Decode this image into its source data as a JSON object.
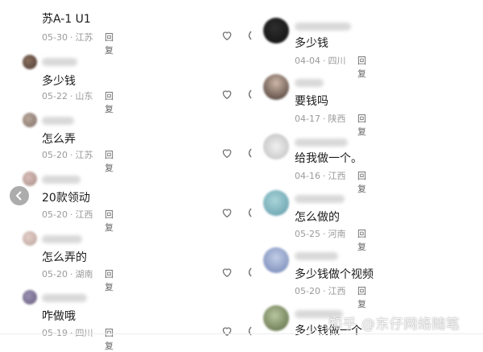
{
  "reply_label": "回复",
  "meta_separator": "·",
  "left_comments": [
    {
      "text": "苏A-1  U1",
      "date": "05-30",
      "location": "江苏"
    },
    {
      "text": "多少钱",
      "date": "05-22",
      "location": "山东"
    },
    {
      "text": "怎么弄",
      "date": "05-20",
      "location": "江苏"
    },
    {
      "text": "20款领动",
      "date": "05-20",
      "location": "江西"
    },
    {
      "text": "怎么弄的",
      "date": "05-20",
      "location": "湖南"
    },
    {
      "text": "咋做哦",
      "date": "05-19",
      "location": "四川"
    }
  ],
  "right_comments": [
    {
      "text": "多少钱",
      "date": "04-04",
      "location": "四川"
    },
    {
      "text": "要钱吗",
      "date": "04-17",
      "location": "陕西"
    },
    {
      "text": "给我做一个。",
      "date": "04-16",
      "location": "江西"
    },
    {
      "text": "怎么做的",
      "date": "05-25",
      "location": "河南"
    },
    {
      "text": "多少钱做个视频",
      "date": "05-20",
      "location": "江西"
    },
    {
      "text": "多少钱做一个",
      "date": "",
      "location": ""
    }
  ],
  "watermark": "知乎 @东仔网络随笔",
  "icons": {
    "like": "heart-icon",
    "prev": "chevron-left-icon"
  },
  "colors": {
    "meta_text": "#9a9a9a",
    "reply_text": "#666666",
    "body_text": "#1a1a1a"
  }
}
